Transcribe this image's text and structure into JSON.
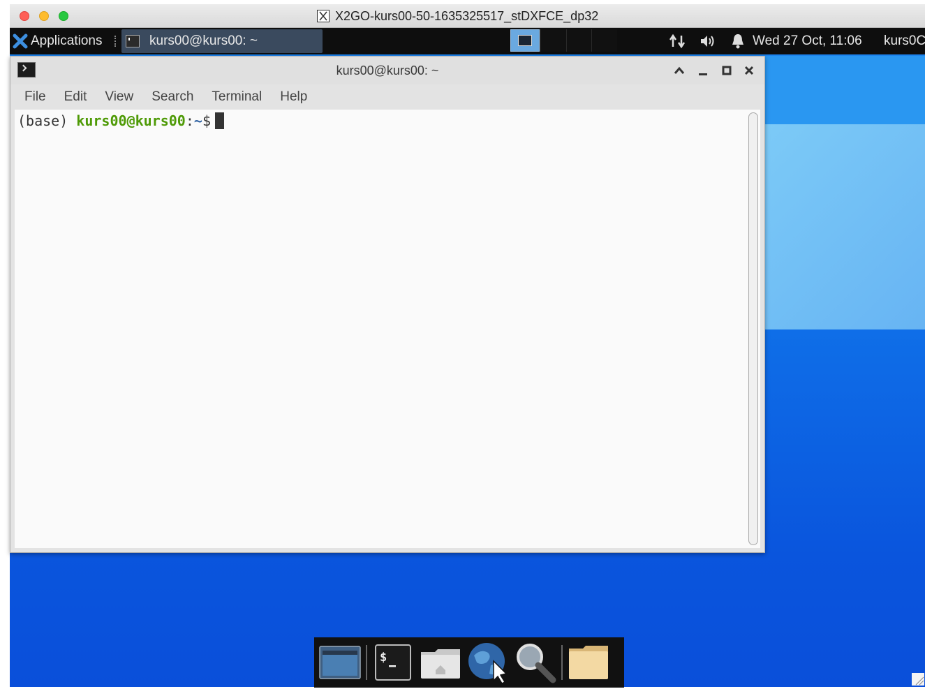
{
  "mac_window": {
    "title": "X2GO-kurs00-50-1635325517_stDXFCE_dp32",
    "icon": "x11-icon"
  },
  "panel": {
    "applications_label": "Applications",
    "task_label": "kurs00@kurs00: ~",
    "clock": "Wed 27 Oct, 11:06",
    "user": "kurs0C",
    "tray_icons": [
      "network-icon",
      "volume-icon",
      "notification-bell-icon"
    ]
  },
  "terminal": {
    "title": "kurs00@kurs00: ~",
    "menu": [
      "File",
      "Edit",
      "View",
      "Search",
      "Terminal",
      "Help"
    ],
    "prompt_env": "(base) ",
    "prompt_user": "kurs00@kurs00",
    "prompt_sep": ":",
    "prompt_path": "~",
    "prompt_symbol": "$"
  },
  "dock": {
    "items": [
      "show-desktop-icon",
      "terminal-icon",
      "home-folder-icon",
      "web-browser-icon",
      "search-icon",
      "folder-icon"
    ]
  },
  "colors": {
    "desktop_blue": "#0f6fe8",
    "prompt_green": "#4e9a06",
    "prompt_blue": "#3465a4",
    "panel_bg": "#0e0e0e"
  }
}
